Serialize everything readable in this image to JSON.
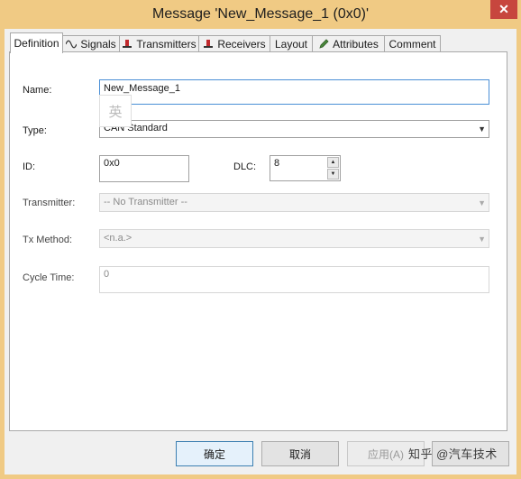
{
  "window": {
    "title": "Message 'New_Message_1 (0x0)'",
    "close_glyph": "✕"
  },
  "tabs": [
    {
      "label": "Definition",
      "icon": ""
    },
    {
      "label": "Signals",
      "icon": "signal-wave-icon"
    },
    {
      "label": "Transmitters",
      "icon": "antenna-icon"
    },
    {
      "label": "Receivers",
      "icon": "antenna-icon"
    },
    {
      "label": "Layout",
      "icon": ""
    },
    {
      "label": "Attributes",
      "icon": "pencil-icon"
    },
    {
      "label": "Comment",
      "icon": ""
    }
  ],
  "form": {
    "name_label": "Name:",
    "name_value": "New_Message_1",
    "ime_indicator": "英",
    "type_label": "Type:",
    "type_value": "CAN Standard",
    "id_label": "ID:",
    "id_value": "0x0",
    "dlc_label": "DLC:",
    "dlc_value": "8",
    "transmitter_label": "Transmitter:",
    "transmitter_value": "-- No Transmitter --",
    "tx_method_label": "Tx Method:",
    "tx_method_value": "<n.a.>",
    "cycle_time_label": "Cycle Time:",
    "cycle_time_value": "0"
  },
  "buttons": {
    "ok": "确定",
    "cancel": "取消",
    "apply": "应用(A)"
  },
  "watermark": "知乎 @汽车技术"
}
